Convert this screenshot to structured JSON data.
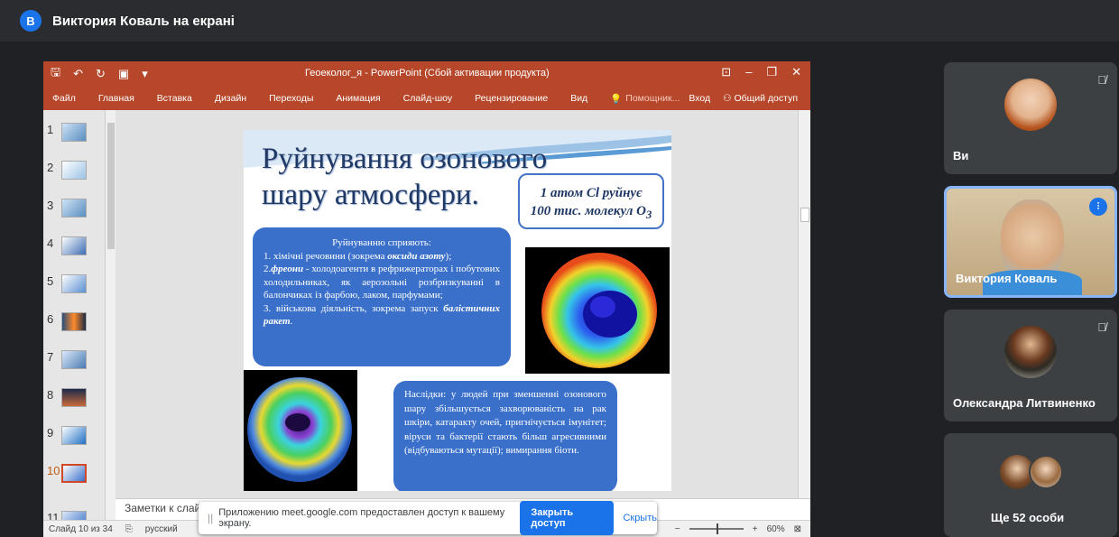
{
  "meet": {
    "presenter_initial": "В",
    "presenter_title": "Виктория Коваль на екрані"
  },
  "ppt": {
    "window_title": "Геоеколог_я - PowerPoint (Сбой активации продукта)",
    "ribbon_tabs": [
      "Файл",
      "Главная",
      "Вставка",
      "Дизайн",
      "Переходы",
      "Анимация",
      "Слайд-шоу",
      "Рецензирование",
      "Вид"
    ],
    "tell_me": "Помощник...",
    "signin": "Вход",
    "share": "Общий доступ",
    "thumbnail_numbers": [
      "1",
      "2",
      "3",
      "4",
      "5",
      "6",
      "7",
      "8",
      "9",
      "10",
      "11"
    ],
    "notes_placeholder": "Заметки к слай",
    "status_slide": "Слайд 10 из 34",
    "status_lang": "русский",
    "zoom_level": "60%"
  },
  "slide": {
    "title_line1": "Руйнування озонового",
    "title_line2": "шару атмосфери.",
    "fact_line1": "1 атом Cl руйнує",
    "fact_line2": "100 тис. молекул O",
    "fact_sub": "3",
    "causes_heading": "Руйнуванню сприяють:",
    "causes_1a": "1. хімічні речовини (зокрема ",
    "causes_1b": "оксиди азоту",
    "causes_1c": ");",
    "causes_2a": "2.",
    "causes_2b": "фреони",
    "causes_2c": " - холодоагенти в рефрижераторах і побутових холодильниках, як аерозольні розбризкуванні в балончиках із фарбою, лаком, парфумами;",
    "causes_3a": "3. військова діяльність, зокрема запуск ",
    "causes_3b": "балістичних ракет",
    "causes_3c": ".",
    "effects_text": "Наслідки: у людей при зменшенні озонового шару збільшується захворюваність на рак шкіри, катаракту очей, пригнічується імунітет; віруси та бактерії стають більш агресивними (відбуваються мутації); вимирання біоти."
  },
  "share_banner": {
    "text": "Приложению meet.google.com предоставлен доступ к вашему экрану.",
    "stop_label": "Закрыть доступ",
    "hide_label": "Скрыть"
  },
  "participants": [
    {
      "name": "Ви",
      "muted": true
    },
    {
      "name": "Виктория Коваль",
      "speaking": true
    },
    {
      "name": "Олександра Литвиненко",
      "muted": true
    },
    {
      "name": "Ще 52 особи"
    }
  ]
}
